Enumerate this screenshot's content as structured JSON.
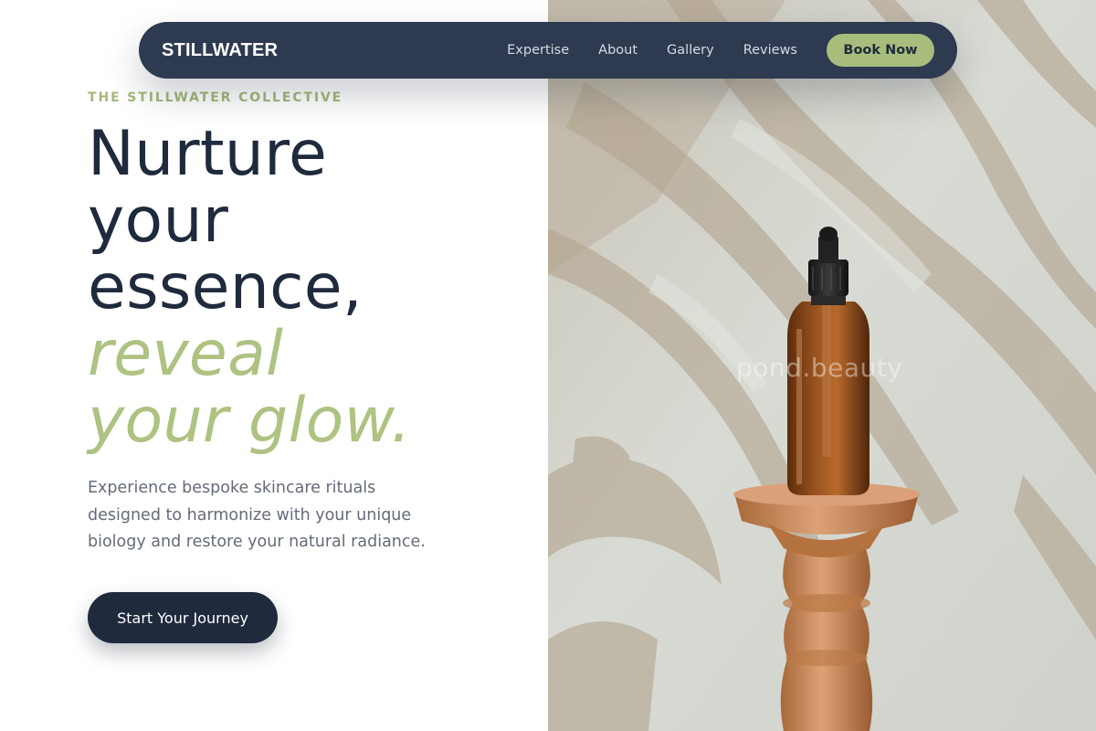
{
  "nav": {
    "brand": "STILLWATER",
    "links": [
      "Expertise",
      "About",
      "Gallery",
      "Reviews"
    ],
    "book_label": "Book Now"
  },
  "hero": {
    "eyebrow": "THE STILLWATER COLLECTIVE",
    "headline_lines": [
      "Nurture",
      "your",
      "essence,"
    ],
    "headline_accent_lines": [
      "reveal",
      "your glow."
    ],
    "description": "Experience bespoke skincare rituals designed to harmonize with your unique biology and restore your natural radiance.",
    "cta_label": "Start Your Journey",
    "image_watermark": "pond.beauty"
  },
  "colors": {
    "navy": "#1f2a3d",
    "nav_bg": "#2e3a4f",
    "sage_accent": "#a8bd7c",
    "body_text": "#646b78",
    "image_wall": "#d6d9d2",
    "bottle_amber": "#8a4a1c",
    "pedestal_wood": "#c8844e"
  },
  "icons": {
    "hero_image": "amber-serum-bottle-photo"
  }
}
